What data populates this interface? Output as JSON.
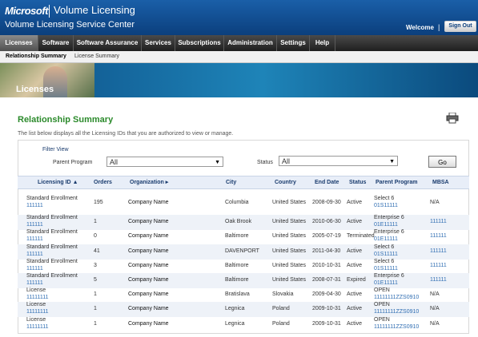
{
  "header": {
    "brand": "Microsoft",
    "product": "Volume Licensing",
    "center_title": "Volume Licensing Service Center",
    "welcome": "Welcome",
    "separator": "|",
    "signout_label": "Sign Out"
  },
  "nav": {
    "items": [
      {
        "label": "Licenses"
      },
      {
        "label": "Software"
      },
      {
        "label": "Software Assurance"
      },
      {
        "label": "Services"
      },
      {
        "label": "Subscriptions"
      },
      {
        "label": "Administration"
      },
      {
        "label": "Settings"
      },
      {
        "label": "Help"
      }
    ]
  },
  "subnav": {
    "items": [
      {
        "label": "Relationship Summary"
      },
      {
        "label": "License Summary"
      }
    ]
  },
  "banner": {
    "title": "Licenses"
  },
  "page": {
    "title": "Relationship Summary",
    "description": "The list below displays all the Licensing IDs that you are authorized to view or manage."
  },
  "filter": {
    "label": "Filter View",
    "parent_program_label": "Parent Program",
    "parent_program_value": "All",
    "status_label": "Status",
    "status_value": "All",
    "go_label": "Go"
  },
  "table": {
    "columns": {
      "licensing_id": "Licensing ID",
      "orders": "Orders",
      "organization": "Organization",
      "city": "City",
      "country": "Country",
      "end_date": "End Date",
      "status": "Status",
      "parent_program": "Parent Program",
      "mbsa": "MBSA"
    },
    "rows": [
      {
        "id_type": "Standard Enrollment",
        "id": "111111",
        "orders": "195",
        "org": "Company Name",
        "city": "Columbia",
        "country": "United States",
        "end": "2008-09-30",
        "status": "Active",
        "pp1": "Select 6",
        "pp2": "01S11111",
        "mbsa": "N/A"
      },
      {
        "id_type": "Standard Enrollment",
        "id": "111111",
        "orders": "1",
        "org": "Company Name",
        "city": "Oak Brook",
        "country": "United States",
        "end": "2010-06-30",
        "status": "Active",
        "pp1": "Enterprise 6",
        "pp2": "01E11111",
        "mbsa": "111111"
      },
      {
        "id_type": "Standard Enrollment",
        "id": "111111",
        "orders": "0",
        "org": "Company Name",
        "city": "Baltimore",
        "country": "United States",
        "end": "2005-07-19",
        "status": "Terminated",
        "pp1": "Enterprise 6",
        "pp2": "01E11111",
        "mbsa": "111111"
      },
      {
        "id_type": "Standard Enrollment",
        "id": "111111",
        "orders": "41",
        "org": "Company Name",
        "city": "DAVENPORT",
        "country": "United States",
        "end": "2011-04-30",
        "status": "Active",
        "pp1": "Select 6",
        "pp2": "01S11111",
        "mbsa": "111111"
      },
      {
        "id_type": "Standard Enrollment",
        "id": "111111",
        "orders": "3",
        "org": "Company Name",
        "city": "Baltimore",
        "country": "United States",
        "end": "2010-10-31",
        "status": "Active",
        "pp1": "Select 6",
        "pp2": "01S11111",
        "mbsa": "111111"
      },
      {
        "id_type": "Standard Enrollment",
        "id": "111111",
        "orders": "5",
        "org": "Company Name",
        "city": "Baltimore",
        "country": "United States",
        "end": "2008-07-31",
        "status": "Expired",
        "pp1": "Enterprise 6",
        "pp2": "01E11111",
        "mbsa": "111111"
      },
      {
        "id_type": "License",
        "id": "11111111",
        "orders": "1",
        "org": "Company Name",
        "city": "Bratislava",
        "country": "Slovakia",
        "end": "2009-04-30",
        "status": "Active",
        "pp1": "OPEN",
        "pp2": "11111111ZZS0910",
        "mbsa": "N/A"
      },
      {
        "id_type": "License",
        "id": "11111111",
        "orders": "1",
        "org": "Company Name",
        "city": "Legnica",
        "country": "Poland",
        "end": "2009-10-31",
        "status": "Active",
        "pp1": "OPEN",
        "pp2": "11111111ZZS0910",
        "mbsa": "N/A"
      },
      {
        "id_type": "License",
        "id": "11111111",
        "orders": "1",
        "org": "Company Name",
        "city": "Legnica",
        "country": "Poland",
        "end": "2009-10-31",
        "status": "Active",
        "pp1": "OPEN",
        "pp2": "11111111ZZS0910",
        "mbsa": "N/A"
      }
    ]
  }
}
